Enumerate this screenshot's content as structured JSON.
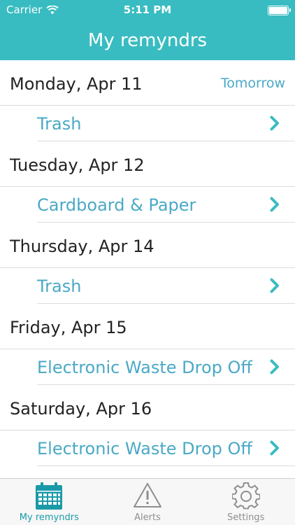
{
  "status_bar": {
    "carrier": "Carrier",
    "time": "5:11 PM",
    "battery_level": 1.0
  },
  "nav": {
    "title": "My remyndrs"
  },
  "days": [
    {
      "date": "Monday, Apr 11",
      "note": "Tomorrow",
      "items": [
        "Trash"
      ]
    },
    {
      "date": "Tuesday, Apr 12",
      "note": "",
      "items": [
        "Cardboard & Paper"
      ]
    },
    {
      "date": "Thursday, Apr 14",
      "note": "",
      "items": [
        "Trash"
      ]
    },
    {
      "date": "Friday, Apr 15",
      "note": "",
      "items": [
        "Electronic Waste Drop Off"
      ]
    },
    {
      "date": "Saturday, Apr 16",
      "note": "",
      "items": [
        "Electronic Waste Drop Off"
      ]
    }
  ],
  "tabs": [
    {
      "label": "My remyndrs",
      "icon": "calendar-icon",
      "active": true
    },
    {
      "label": "Alerts",
      "icon": "warning-icon",
      "active": false
    },
    {
      "label": "Settings",
      "icon": "gear-icon",
      "active": false
    }
  ],
  "colors": {
    "accent": "#38bcc1",
    "link": "#4aa9c6",
    "active_tab": "#1a9aa8"
  }
}
